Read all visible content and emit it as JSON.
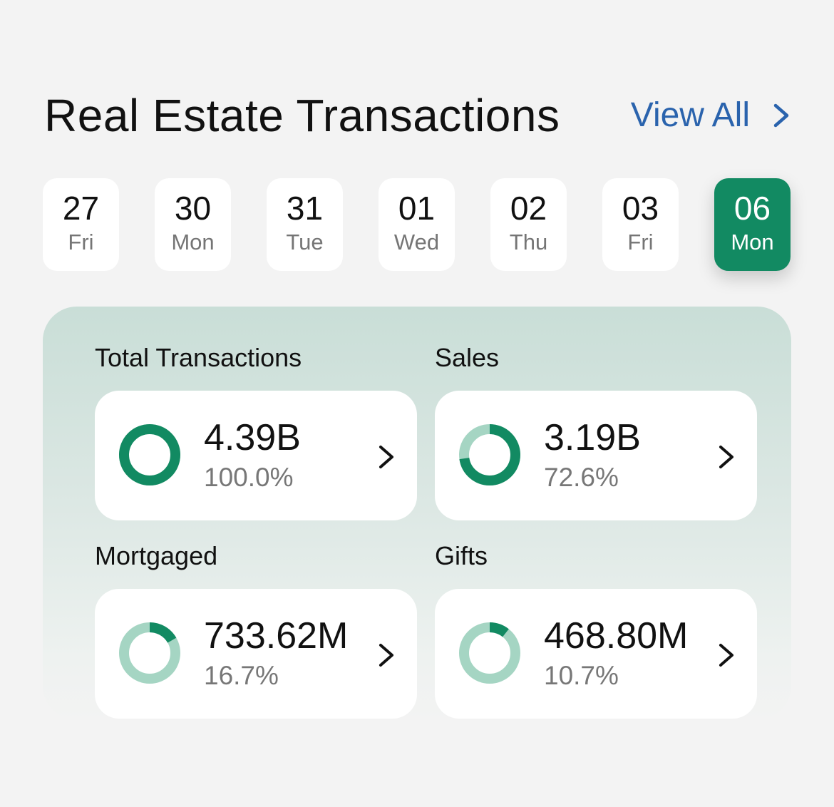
{
  "header": {
    "title": "Real Estate Transactions",
    "view_all_label": "View All"
  },
  "dates": [
    {
      "day": "27",
      "weekday": "Fri",
      "selected": false
    },
    {
      "day": "30",
      "weekday": "Mon",
      "selected": false
    },
    {
      "day": "31",
      "weekday": "Tue",
      "selected": false
    },
    {
      "day": "01",
      "weekday": "Wed",
      "selected": false
    },
    {
      "day": "02",
      "weekday": "Thu",
      "selected": false
    },
    {
      "day": "03",
      "weekday": "Fri",
      "selected": false
    },
    {
      "day": "06",
      "weekday": "Mon",
      "selected": true
    }
  ],
  "stats": [
    {
      "label": "Total Transactions",
      "value": "4.39B",
      "percent": "100.0%",
      "fraction": 1.0
    },
    {
      "label": "Sales",
      "value": "3.19B",
      "percent": "72.6%",
      "fraction": 0.726
    },
    {
      "label": "Mortgaged",
      "value": "733.62M",
      "percent": "16.7%",
      "fraction": 0.167
    },
    {
      "label": "Gifts",
      "value": "468.80M",
      "percent": "10.7%",
      "fraction": 0.107
    }
  ],
  "colors": {
    "accent": "#128a62",
    "donut_track": "#a5d5c3",
    "link": "#2a63ad",
    "background": "#f3f3f3"
  },
  "icons": {
    "view_all": "chevron-right-icon",
    "card_arrow": "chevron-right-icon",
    "stat": "donut-chart-icon"
  }
}
